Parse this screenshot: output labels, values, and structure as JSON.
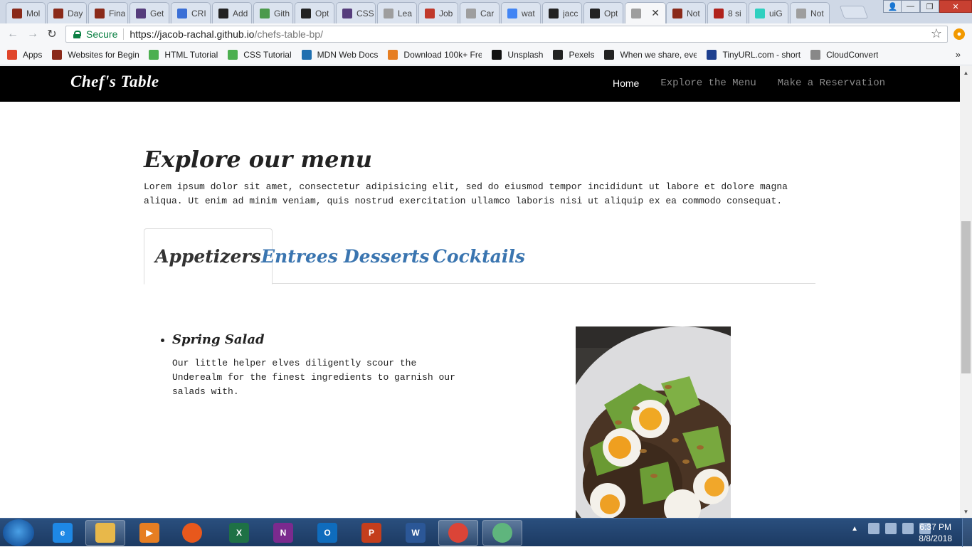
{
  "browser": {
    "tabs": [
      {
        "title": "Mol",
        "icon": "cow-icon",
        "color": "#8a2a1a"
      },
      {
        "title": "Day",
        "icon": "cow-icon",
        "color": "#8a2a1a"
      },
      {
        "title": "Fina",
        "icon": "cow-icon",
        "color": "#8a2a1a"
      },
      {
        "title": "Get",
        "icon": "bootstrap-icon",
        "color": "#563d7c"
      },
      {
        "title": "CRI",
        "icon": "grid-icon",
        "color": "#3b6fd6"
      },
      {
        "title": "Add",
        "icon": "github-icon",
        "color": "#222222"
      },
      {
        "title": "Gith",
        "icon": "github-icon",
        "color": "#4c9a4c"
      },
      {
        "title": "Opt",
        "icon": "github-icon",
        "color": "#222222"
      },
      {
        "title": "CSS",
        "icon": "bootstrap-icon",
        "color": "#563d7c"
      },
      {
        "title": "Lea",
        "icon": "page-icon",
        "color": "#9e9e9e"
      },
      {
        "title": "Job",
        "icon": "job-icon",
        "color": "#c0392b"
      },
      {
        "title": "Car",
        "icon": "page-icon",
        "color": "#9e9e9e"
      },
      {
        "title": "wat",
        "icon": "google-icon",
        "color": "#4285f4"
      },
      {
        "title": "jacc",
        "icon": "github-icon",
        "color": "#222222"
      },
      {
        "title": "Opt",
        "icon": "github-icon",
        "color": "#222222"
      },
      {
        "title": "",
        "icon": "page-icon",
        "color": "#9e9e9e",
        "active": true
      },
      {
        "title": "Not",
        "icon": "cow-icon",
        "color": "#8a2a1a"
      },
      {
        "title": "8 si",
        "icon": "w-icon",
        "color": "#b0221c"
      },
      {
        "title": "uiG",
        "icon": "gradient-icon",
        "color": "#2fd0c0"
      },
      {
        "title": "Not",
        "icon": "page-icon",
        "color": "#9e9e9e"
      }
    ],
    "secure_label": "Secure",
    "url_domain": "https://jacob-rachal.github.io",
    "url_path": "/chefs-table-bp/",
    "bookmarks": [
      {
        "label": "Apps",
        "icon": "apps-icon",
        "color": "#e0452b"
      },
      {
        "label": "Websites for Beginn",
        "icon": "cow-icon",
        "color": "#8a2a1a"
      },
      {
        "label": "HTML Tutorial",
        "icon": "w3-icon",
        "color": "#4caf50"
      },
      {
        "label": "CSS Tutorial",
        "icon": "w3-icon",
        "color": "#4caf50"
      },
      {
        "label": "MDN Web Docs",
        "icon": "mdn-icon",
        "color": "#1f6fb0"
      },
      {
        "label": "Download 100k+ Fre",
        "icon": "v-icon",
        "color": "#e67e22"
      },
      {
        "label": "Unsplash",
        "icon": "camera-icon",
        "color": "#111111"
      },
      {
        "label": "Pexels",
        "icon": "camera-icon",
        "color": "#222222"
      },
      {
        "label": "When we share, eve",
        "icon": "cc-icon",
        "color": "#222222"
      },
      {
        "label": "TinyURL.com - short",
        "icon": "tinyurl-icon",
        "color": "#1d3f8f"
      },
      {
        "label": "CloudConvert",
        "icon": "cloud-icon",
        "color": "#888888"
      }
    ]
  },
  "site": {
    "brand": "Chef's Table",
    "nav": [
      "Home",
      "Explore the Menu",
      "Make a Reservation"
    ],
    "heading": "Explore our menu",
    "intro": "Lorem ipsum dolor sit amet, consectetur adipisicing elit, sed do eiusmod tempor incididunt ut labore et dolore magna aliqua. Ut enim ad minim veniam, quis nostrud exercitation ullamco laboris nisi ut aliquip ex ea commodo consequat.",
    "tabs": [
      "Appetizers",
      "Entrees",
      "Desserts",
      "Cocktails"
    ],
    "active_tab": "Appetizers",
    "dish": {
      "name": "Spring Salad",
      "description": "Our little helper elves diligently scour the Underealm for the finest ingredients to garnish our salads with."
    }
  },
  "taskbar": {
    "apps": [
      {
        "name": "internet-explorer",
        "label": "e",
        "color": "#1e88e5"
      },
      {
        "name": "file-explorer",
        "label": "",
        "color": "#e8b84a"
      },
      {
        "name": "media-player",
        "label": "▶",
        "color": "#e67e22"
      },
      {
        "name": "firefox",
        "label": "",
        "color": "#e8581c"
      },
      {
        "name": "excel",
        "label": "X",
        "color": "#1e7145"
      },
      {
        "name": "onenote",
        "label": "N",
        "color": "#7b2a8e"
      },
      {
        "name": "outlook",
        "label": "O",
        "color": "#0f6cbd"
      },
      {
        "name": "powerpoint",
        "label": "P",
        "color": "#c43e1c"
      },
      {
        "name": "word",
        "label": "W",
        "color": "#2b5797"
      },
      {
        "name": "chrome",
        "label": "",
        "color": "#db4437"
      },
      {
        "name": "atom",
        "label": "",
        "color": "#5fb57d"
      }
    ],
    "time": "6:37 PM",
    "date": "8/8/2018"
  }
}
